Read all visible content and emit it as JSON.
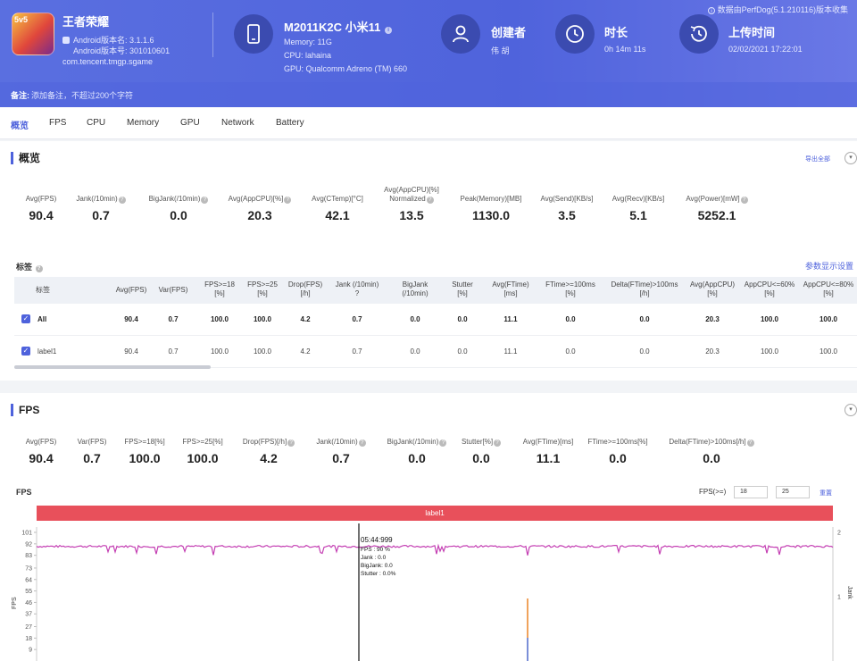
{
  "header": {
    "app_name": "王者荣耀",
    "app_icon_badge": "5v5",
    "android_version_name": "Android版本名: 3.1.1.6",
    "android_version_code": "Android版本号: 301010601",
    "package": "com.tencent.tmgp.sgame",
    "device_title": "M2011K2C 小米11",
    "memory": "Memory: 11G",
    "cpu": "CPU: lahaina",
    "gpu": "GPU: Qualcomm Adreno (TM) 660",
    "creator_label": "创建者",
    "creator_value": "伟 胡",
    "duration_label": "时长",
    "duration_value": "0h 14m 11s",
    "upload_label": "上传时间",
    "upload_value": "02/02/2021 17:22:01",
    "notice": "数据由PerfDog(5.1.210116)版本收集",
    "remark_label": "备注:",
    "remark_placeholder": "添加备注，不超过200个字符"
  },
  "tabs": [
    "概览",
    "FPS",
    "CPU",
    "Memory",
    "GPU",
    "Network",
    "Battery"
  ],
  "overview": {
    "title": "概览",
    "export_label": "导出全部",
    "metrics": [
      {
        "label": "Avg(FPS)",
        "value": "90.4",
        "help": false
      },
      {
        "label": "Jank(/10min)",
        "value": "0.7",
        "help": true
      },
      {
        "label": "BigJank(/10min)",
        "value": "0.0",
        "help": true
      },
      {
        "label": "Avg(AppCPU)[%]",
        "value": "20.3",
        "help": true
      },
      {
        "label": "Avg(CTemp)[°C]",
        "value": "42.1",
        "help": false
      },
      {
        "label": "Avg(AppCPU)[%]",
        "label2": "Normalized",
        "value": "13.5",
        "help": true
      },
      {
        "label": "Peak(Memory)[MB]",
        "value": "1130.0",
        "help": false
      },
      {
        "label": "Avg(Send)[KB/s]",
        "value": "3.5",
        "help": false
      },
      {
        "label": "Avg(Recv)[KB/s]",
        "value": "5.1",
        "help": false
      },
      {
        "label": "Avg(Power)[mW]",
        "value": "5252.1",
        "help": true
      }
    ],
    "tag_title": "标签",
    "param_settings": "参数显示设置",
    "table": {
      "headers": [
        {
          "l1": "标签",
          "l2": ""
        },
        {
          "l1": "Avg(FPS)",
          "l2": ""
        },
        {
          "l1": "Var(FPS)",
          "l2": ""
        },
        {
          "l1": "FPS>=18",
          "l2": "[%]"
        },
        {
          "l1": "FPS>=25",
          "l2": "[%]"
        },
        {
          "l1": "Drop(FPS)",
          "l2": "[/h]"
        },
        {
          "l1": "Jank (/10min)",
          "l2": "?"
        },
        {
          "l1": "BigJank",
          "l2": "(/10min)"
        },
        {
          "l1": "Stutter",
          "l2": "[%]"
        },
        {
          "l1": "Avg(FTime)",
          "l2": "[ms]"
        },
        {
          "l1": "FTime>=100ms",
          "l2": "[%]"
        },
        {
          "l1": "Delta(FTime)>100ms",
          "l2": "[/h]"
        },
        {
          "l1": "Avg(AppCPU)",
          "l2": "[%]"
        },
        {
          "l1": "AppCPU<=60%",
          "l2": "[%]"
        },
        {
          "l1": "AppCPU<=80%",
          "l2": "[%]"
        }
      ],
      "rows": [
        [
          "All",
          "90.4",
          "0.7",
          "100.0",
          "100.0",
          "4.2",
          "0.7",
          "0.0",
          "0.0",
          "11.1",
          "0.0",
          "0.0",
          "20.3",
          "100.0",
          "100.0"
        ],
        [
          "label1",
          "90.4",
          "0.7",
          "100.0",
          "100.0",
          "4.2",
          "0.7",
          "0.0",
          "0.0",
          "11.1",
          "0.0",
          "0.0",
          "20.3",
          "100.0",
          "100.0"
        ]
      ]
    }
  },
  "fps_section": {
    "title": "FPS",
    "metrics": [
      {
        "label": "Avg(FPS)",
        "value": "90.4",
        "help": false
      },
      {
        "label": "Var(FPS)",
        "value": "0.7",
        "help": false
      },
      {
        "label": "FPS>=18[%]",
        "value": "100.0",
        "help": false
      },
      {
        "label": "FPS>=25[%]",
        "value": "100.0",
        "help": false
      },
      {
        "label": "Drop(FPS)[/h]",
        "value": "4.2",
        "help": true
      },
      {
        "label": "Jank(/10min)",
        "value": "0.7",
        "help": true
      },
      {
        "label": "BigJank(/10min)",
        "value": "0.0",
        "help": true
      },
      {
        "label": "Stutter[%]",
        "value": "0.0",
        "help": true
      },
      {
        "label": "Avg(FTime)[ms]",
        "value": "11.1",
        "help": false
      },
      {
        "label": "FTime>=100ms[%]",
        "value": "0.0",
        "help": false
      },
      {
        "label": "Delta(FTime)>100ms[/h]",
        "value": "0.0",
        "help": true
      }
    ],
    "chart_title": "FPS",
    "threshold_label": "FPS(>=)",
    "threshold1": "18",
    "threshold2": "25",
    "reset_label": "重置",
    "label_bar": "label1",
    "tooltip": {
      "time": "05:44:999",
      "lines": [
        "FPS    : 90 %",
        "Jank    : 0.0",
        "BigJank: 0.0",
        "Stutter  : 0.0%"
      ]
    },
    "y_axis_label": "FPS",
    "y2_axis_label": "Jank",
    "colors": {
      "fps_line": "#c43fb3",
      "jank_spike": "#f0a35c",
      "label_bar": "#e8505b",
      "accent": "#4e62dc"
    }
  },
  "chart_data": {
    "type": "line",
    "title": "FPS",
    "ylabel": "FPS",
    "y2label": "Jank",
    "y_ticks": [
      101,
      92,
      83,
      73,
      64,
      55,
      46,
      37,
      27,
      18,
      9
    ],
    "y2_ticks": [
      2,
      1
    ],
    "ylim": [
      0,
      101
    ],
    "y2lim": [
      0,
      2
    ],
    "series": [
      {
        "name": "FPS",
        "values_summary": "approximately constant near 90 with small dips",
        "approx_value": 90
      }
    ]
  }
}
